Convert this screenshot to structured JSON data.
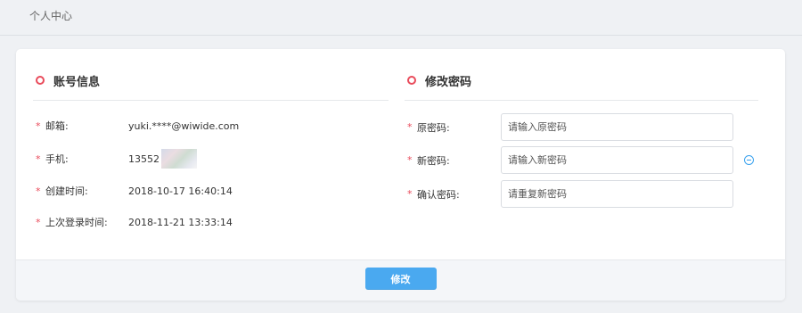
{
  "page": {
    "title": "个人中心"
  },
  "account_info": {
    "title": "账号信息",
    "rows": [
      {
        "required": "*",
        "label": "邮箱:",
        "value": "yuki.****@wiwide.com"
      },
      {
        "required": "*",
        "label": "手机:",
        "value": "13552"
      },
      {
        "required": "*",
        "label": "创建时间:",
        "value": "2018-10-17 16:40:14"
      },
      {
        "required": "*",
        "label": "上次登录时间:",
        "value": "2018-11-21 13:33:14"
      }
    ]
  },
  "change_password": {
    "title": "修改密码",
    "fields": [
      {
        "required": "*",
        "label": "原密码:",
        "placeholder": "请输入原密码"
      },
      {
        "required": "*",
        "label": "新密码:",
        "placeholder": "请输入新密码"
      },
      {
        "required": "*",
        "label": "确认密码:",
        "placeholder": "请重复新密码"
      }
    ]
  },
  "footer": {
    "submit_label": "修改"
  },
  "colors": {
    "accent": "#4aa9f0",
    "required": "#e94b5b",
    "title_ring": "#e94b5b"
  },
  "icons": {
    "section_marker": "circle-ring-icon",
    "password_toggle": "minus-circle-icon"
  }
}
